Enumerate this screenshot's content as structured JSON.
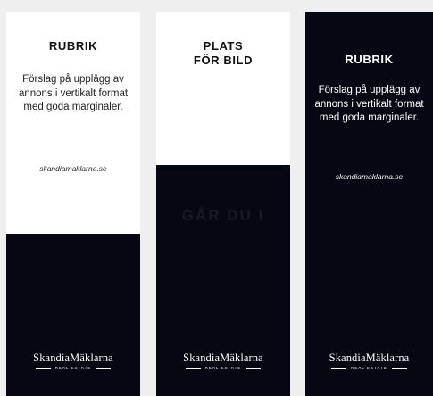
{
  "banners": [
    {
      "heading": "RUBRIK",
      "body": "Förslag på upplägg av annons i vertikalt format med goda marginaler.",
      "website": "skandiamaklarna.se",
      "logo": {
        "name": "SkandiaMäklarna",
        "sub": "REAL ESTATE"
      }
    },
    {
      "heading_line1": "PLATS",
      "heading_line2": "FÖR BILD",
      "ghost_text": "GÅR DU I",
      "logo": {
        "name": "SkandiaMäklarna",
        "sub": "REAL ESTATE"
      }
    },
    {
      "heading": "RUBRIK",
      "body": "Förslag på upplägg av annons i vertikalt format med goda marginaler.",
      "website": "skandiamaklarna.se",
      "logo": {
        "name": "SkandiaMäklarna",
        "sub": "REAL ESTATE"
      }
    }
  ],
  "colors": {
    "navy": "#050812",
    "white": "#ffffff",
    "background": "#efefef"
  }
}
